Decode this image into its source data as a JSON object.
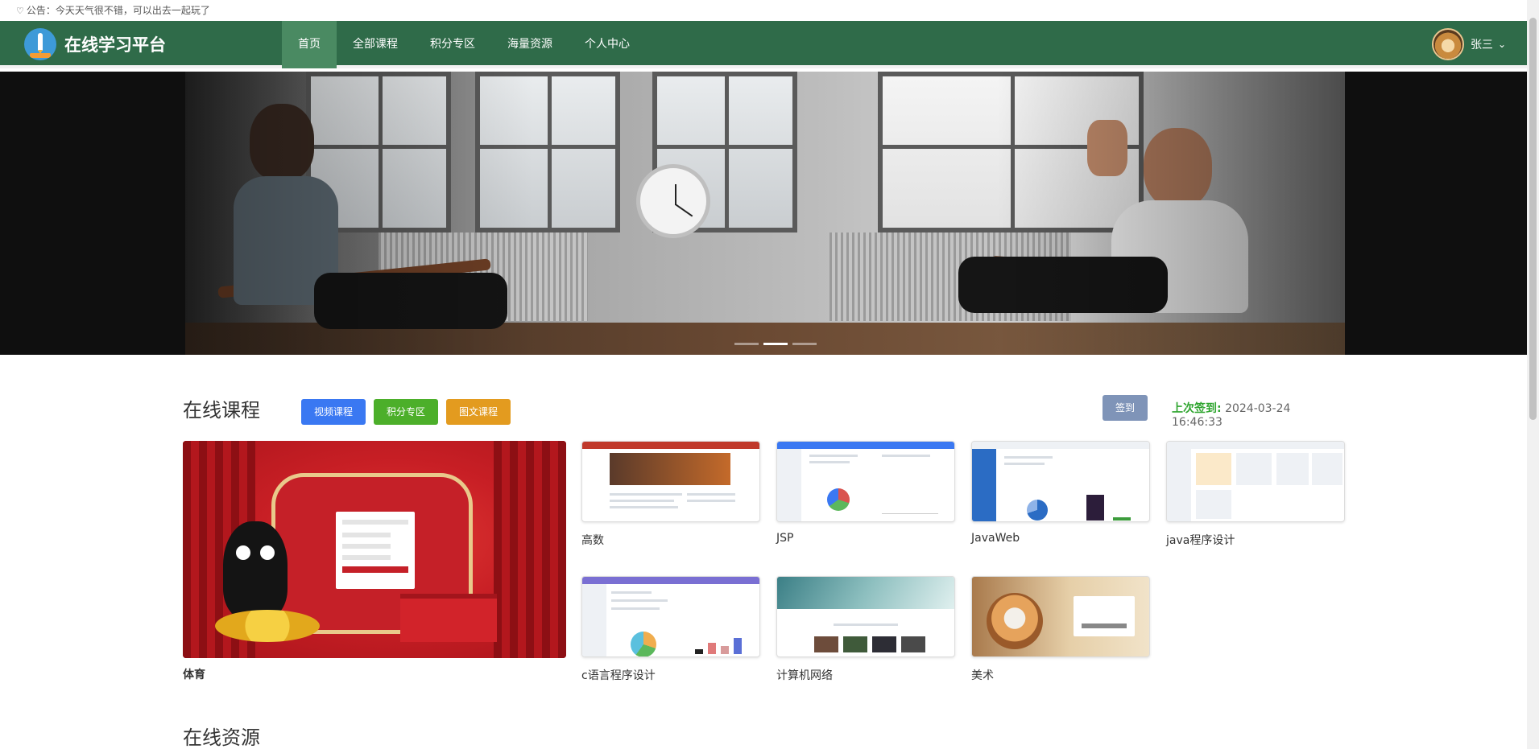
{
  "notice": {
    "icon": "bell-icon",
    "text": "公告：今天天气很不错，可以出去一起玩了"
  },
  "header": {
    "brand_title": "在线学习平台",
    "nav": [
      {
        "label": "首页",
        "active": true
      },
      {
        "label": "全部课程",
        "active": false
      },
      {
        "label": "积分专区",
        "active": false
      },
      {
        "label": "海量资源",
        "active": false
      },
      {
        "label": "个人中心",
        "active": false
      }
    ],
    "user_name": "张三",
    "colors": {
      "nav_bg": "#2f6b49",
      "nav_active": "#4a8a62"
    }
  },
  "banner": {
    "active_slide": 1,
    "slide_count": 3
  },
  "courses": {
    "title": "在线课程",
    "filters": [
      {
        "label": "视频课程",
        "color": "#3a78f2"
      },
      {
        "label": "积分专区",
        "color": "#4caf2a"
      },
      {
        "label": "图文课程",
        "color": "#e39b1f"
      }
    ],
    "signin_label": "签到",
    "last_signin_label": "上次签到:",
    "last_signin_time": "2024-03-24 16:46:33",
    "featured": {
      "title": "体育"
    },
    "items": [
      {
        "title": "高数"
      },
      {
        "title": "JSP"
      },
      {
        "title": "JavaWeb"
      },
      {
        "title": "java程序设计"
      },
      {
        "title": "c语言程序设计"
      },
      {
        "title": "计算机网络"
      },
      {
        "title": "美术"
      }
    ]
  },
  "resources": {
    "title": "在线资源"
  }
}
